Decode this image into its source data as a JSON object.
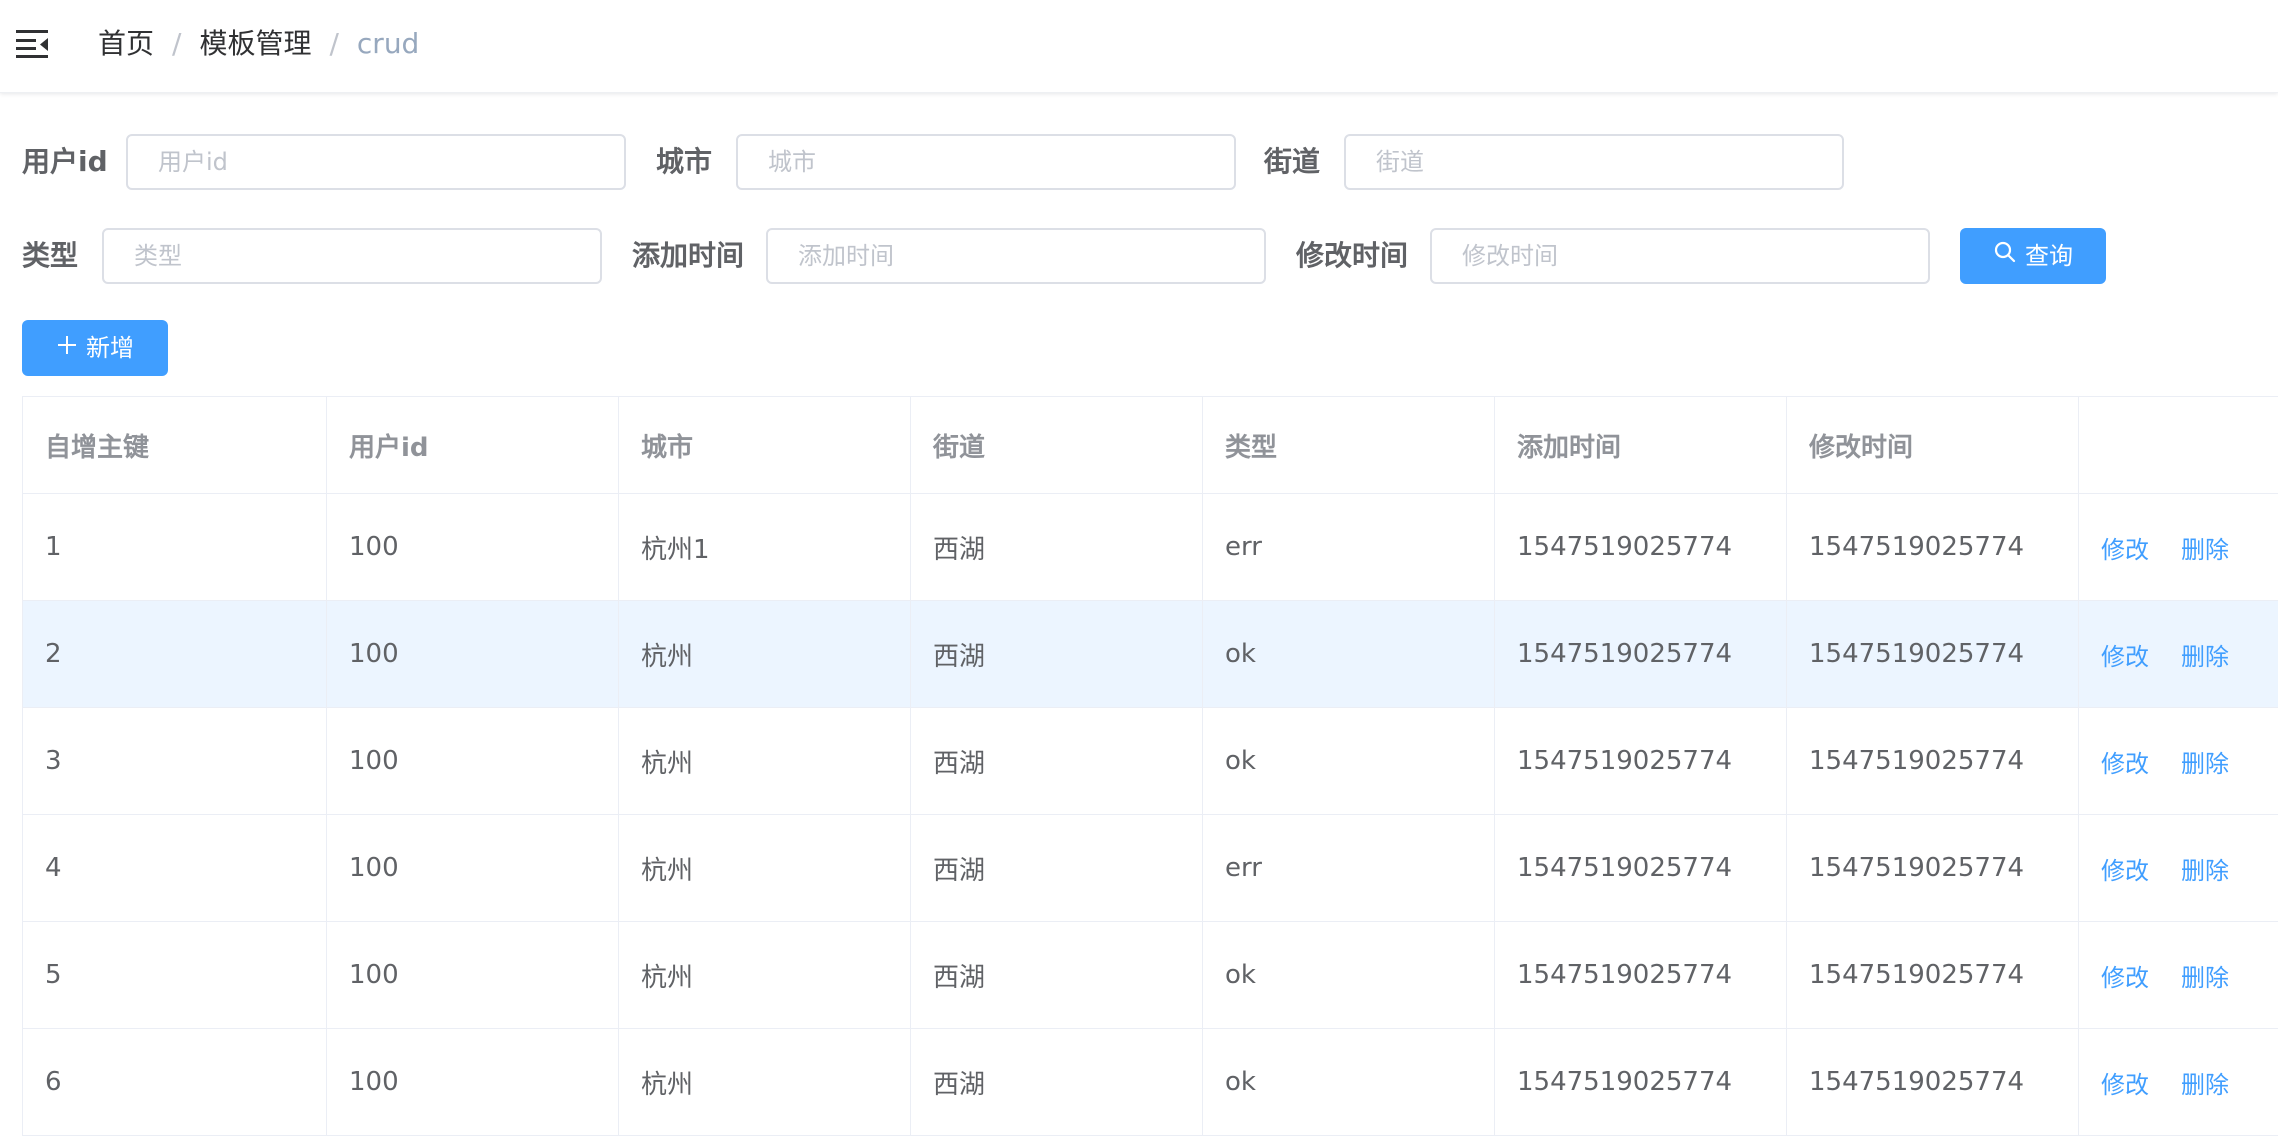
{
  "breadcrumb": {
    "items": [
      "首页",
      "模板管理",
      "crud"
    ],
    "separator": "/"
  },
  "search": {
    "fields": [
      {
        "label": "用户id",
        "placeholder": "用户id"
      },
      {
        "label": "城市",
        "placeholder": "城市"
      },
      {
        "label": "街道",
        "placeholder": "街道"
      },
      {
        "label": "类型",
        "placeholder": "类型"
      },
      {
        "label": "添加时间",
        "placeholder": "添加时间"
      },
      {
        "label": "修改时间",
        "placeholder": "修改时间"
      }
    ],
    "query_label": "查询",
    "add_label": "新增"
  },
  "table": {
    "columns": [
      "自增主键",
      "用户id",
      "城市",
      "街道",
      "类型",
      "添加时间",
      "修改时间",
      ""
    ],
    "rows": [
      {
        "id": "1",
        "user_id": "100",
        "city": "杭州1",
        "street": "西湖",
        "type": "err",
        "created": "1547519025774",
        "updated": "1547519025774",
        "edit": "修改",
        "delete": "删除"
      },
      {
        "id": "2",
        "user_id": "100",
        "city": "杭州",
        "street": "西湖",
        "type": "ok",
        "created": "1547519025774",
        "updated": "1547519025774",
        "edit": "修改",
        "delete": "删除"
      },
      {
        "id": "3",
        "user_id": "100",
        "city": "杭州",
        "street": "西湖",
        "type": "ok",
        "created": "1547519025774",
        "updated": "1547519025774",
        "edit": "修改",
        "delete": "删除"
      },
      {
        "id": "4",
        "user_id": "100",
        "city": "杭州",
        "street": "西湖",
        "type": "err",
        "created": "1547519025774",
        "updated": "1547519025774",
        "edit": "修改",
        "delete": "删除"
      },
      {
        "id": "5",
        "user_id": "100",
        "city": "杭州",
        "street": "西湖",
        "type": "ok",
        "created": "1547519025774",
        "updated": "1547519025774",
        "edit": "修改",
        "delete": "删除"
      },
      {
        "id": "6",
        "user_id": "100",
        "city": "杭州",
        "street": "西湖",
        "type": "ok",
        "created": "1547519025774",
        "updated": "1547519025774",
        "edit": "修改",
        "delete": "删除"
      }
    ]
  },
  "colors": {
    "primary": "#409eff",
    "row_hover": "#ecf5ff",
    "border": "#ebeef5"
  }
}
